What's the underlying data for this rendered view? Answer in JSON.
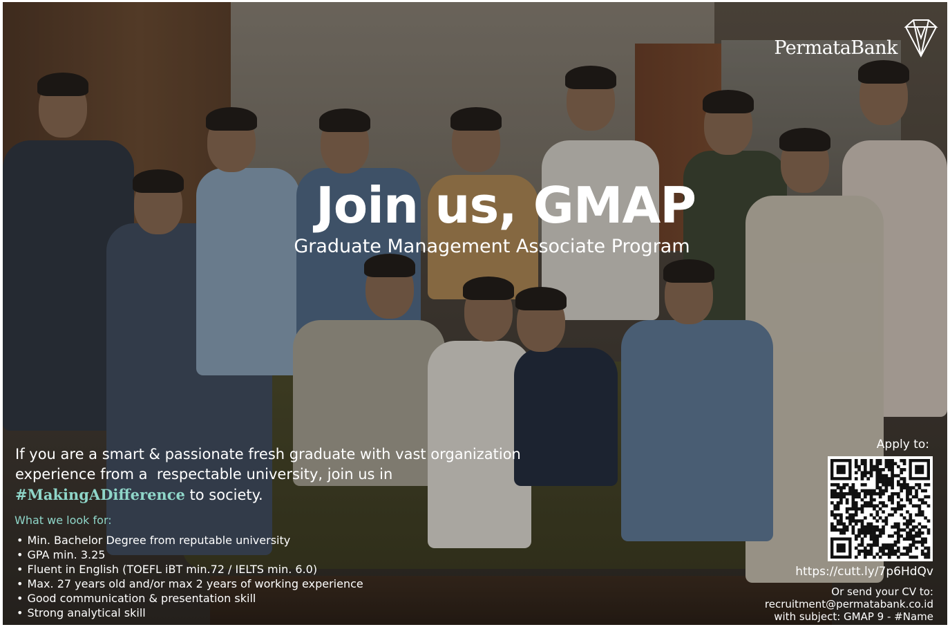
{
  "brand": {
    "name": "PermataBank",
    "logo_icon": "permata-diamond-icon"
  },
  "headline": {
    "title": "Join us, GMAP",
    "subtitle": "Graduate Management Associate Program"
  },
  "intro": {
    "line1": "If you are a smart & passionate fresh graduate with vast organization",
    "line2": "experience from a  respectable university, join us in",
    "hashtag": "#MakingADifference",
    "tail": " to society."
  },
  "requirements": {
    "title": "What we look for:",
    "items": [
      "Min. Bachelor Degree from reputable university",
      "GPA min. 3.25",
      "Fluent in English (TOEFL iBT min.72 / IELTS min. 6.0)",
      "Max. 27 years old and/or max 2 years of working experience",
      "Good communication & presentation skill",
      "Strong analytical skill"
    ]
  },
  "apply": {
    "label": "Apply to:",
    "qr_icon": "qr-code-icon",
    "url": "https://cutt.ly/7p6HdQv",
    "cv_line1": "Or send your CV to:",
    "cv_email": "recruitment@permatabank.co.id",
    "cv_subject": "with subject: GMAP 9 - #Name"
  },
  "colors": {
    "accent": "#8fd6c9",
    "text": "#ffffff"
  }
}
